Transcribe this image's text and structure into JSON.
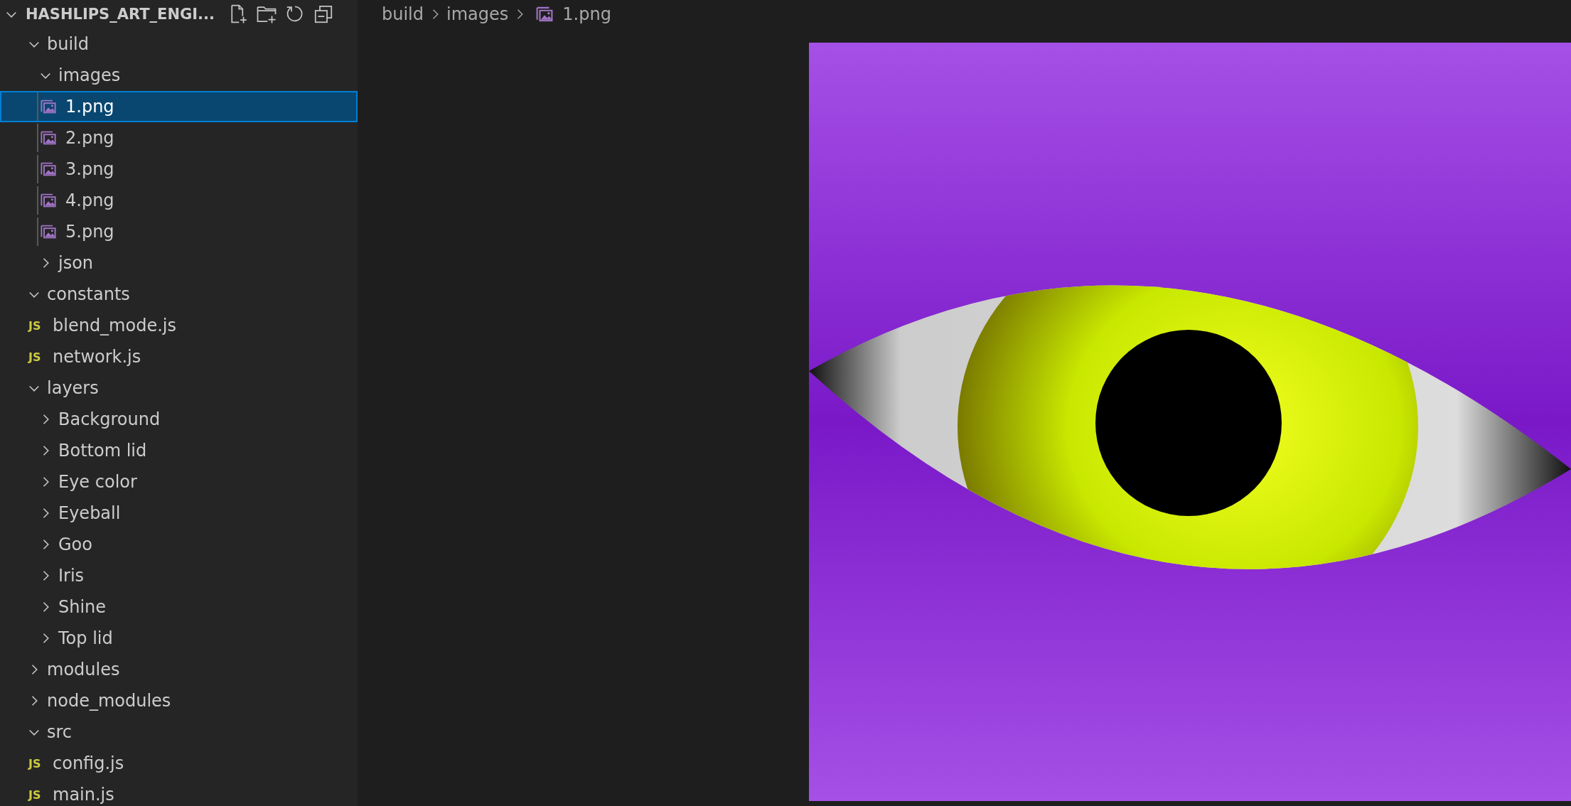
{
  "explorer": {
    "title": "HASHLIPS_ART_ENGI...",
    "expanded": true,
    "items": [
      {
        "kind": "folder",
        "label": "build",
        "expanded": true,
        "selected": false,
        "children": [
          {
            "kind": "folder",
            "label": "images",
            "expanded": true,
            "selected": false,
            "children": [
              {
                "kind": "image",
                "label": "1.png",
                "selected": true
              },
              {
                "kind": "image",
                "label": "2.png",
                "selected": false
              },
              {
                "kind": "image",
                "label": "3.png",
                "selected": false
              },
              {
                "kind": "image",
                "label": "4.png",
                "selected": false
              },
              {
                "kind": "image",
                "label": "5.png",
                "selected": false
              }
            ]
          },
          {
            "kind": "folder",
            "label": "json",
            "expanded": false,
            "selected": false
          }
        ]
      },
      {
        "kind": "folder",
        "label": "constants",
        "expanded": true,
        "selected": false,
        "children": [
          {
            "kind": "js",
            "badge": "JS",
            "label": "blend_mode.js",
            "selected": false
          },
          {
            "kind": "js",
            "badge": "JS",
            "label": "network.js",
            "selected": false
          }
        ]
      },
      {
        "kind": "folder",
        "label": "layers",
        "expanded": true,
        "selected": false,
        "children": [
          {
            "kind": "folder",
            "label": "Background",
            "expanded": false,
            "selected": false
          },
          {
            "kind": "folder",
            "label": "Bottom lid",
            "expanded": false,
            "selected": false
          },
          {
            "kind": "folder",
            "label": "Eye color",
            "expanded": false,
            "selected": false
          },
          {
            "kind": "folder",
            "label": "Eyeball",
            "expanded": false,
            "selected": false
          },
          {
            "kind": "folder",
            "label": "Goo",
            "expanded": false,
            "selected": false
          },
          {
            "kind": "folder",
            "label": "Iris",
            "expanded": false,
            "selected": false
          },
          {
            "kind": "folder",
            "label": "Shine",
            "expanded": false,
            "selected": false
          },
          {
            "kind": "folder",
            "label": "Top lid",
            "expanded": false,
            "selected": false
          }
        ]
      },
      {
        "kind": "folder",
        "label": "modules",
        "expanded": false,
        "selected": false
      },
      {
        "kind": "folder",
        "label": "node_modules",
        "expanded": false,
        "selected": false
      },
      {
        "kind": "folder",
        "label": "src",
        "expanded": true,
        "selected": false,
        "children": [
          {
            "kind": "js",
            "badge": "JS",
            "label": "config.js",
            "selected": false
          },
          {
            "kind": "js",
            "badge": "JS",
            "label": "main.js",
            "selected": false
          }
        ]
      }
    ]
  },
  "breadcrumb": [
    {
      "kind": "folder",
      "label": "build"
    },
    {
      "kind": "folder",
      "label": "images"
    },
    {
      "kind": "image",
      "label": "1.png"
    }
  ]
}
